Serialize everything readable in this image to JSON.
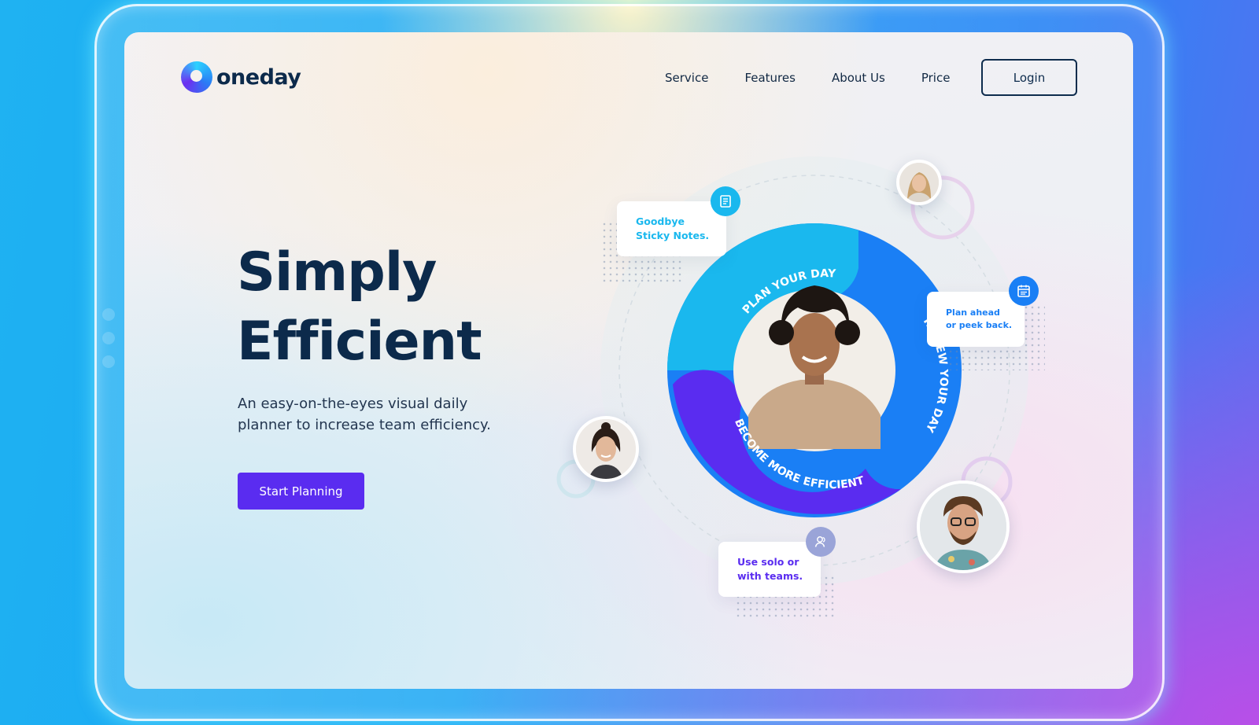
{
  "brand": {
    "name": "oneday"
  },
  "nav": {
    "items": [
      {
        "label": "Service"
      },
      {
        "label": "Features"
      },
      {
        "label": "About Us"
      },
      {
        "label": "Price"
      }
    ],
    "login_label": "Login"
  },
  "hero": {
    "title_line1": "Simply",
    "title_line2": "Efficient",
    "subtitle": "An easy-on-the-eyes visual daily planner to increase team efficiency.",
    "cta_label": "Start Planning"
  },
  "cycle": {
    "segments": [
      {
        "label": "PLAN YOUR DAY",
        "color": "#1ab8ee"
      },
      {
        "label": "REVIEW YOUR DAY",
        "color": "#1a7ff5"
      },
      {
        "label": "BECOME MORE EFFICIENT",
        "color": "#5a2cf0"
      }
    ]
  },
  "cards": {
    "sticky": {
      "line1": "Goodbye",
      "line2": "Sticky Notes.",
      "icon": "note-icon",
      "color": "#1ab8ee"
    },
    "plan": {
      "line1": "Plan ahead",
      "line2": "or peek back.",
      "icon": "calendar-icon",
      "color": "#1a7ff5"
    },
    "solo": {
      "line1": "Use solo or",
      "line2": "with teams.",
      "icon": "users-icon",
      "color": "#5a2cf0"
    }
  },
  "colors": {
    "navy": "#0c2a4b",
    "primary": "#5a2cf0",
    "cyan": "#1ab8ee",
    "blue": "#1a7ff5"
  }
}
